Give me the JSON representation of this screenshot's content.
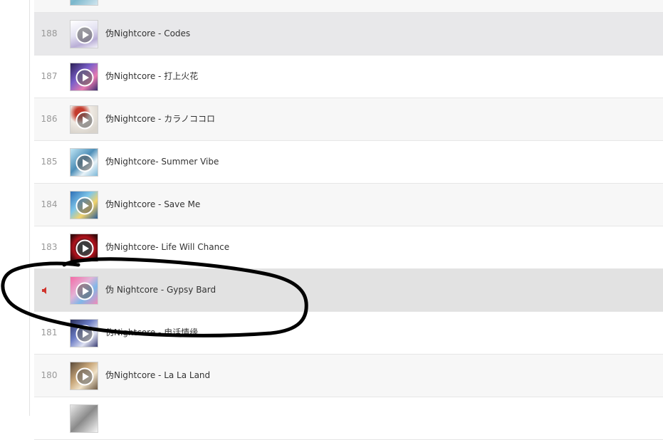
{
  "tracks": [
    {
      "index": "",
      "title": ""
    },
    {
      "index": "188",
      "title": "伪Nightcore - Codes"
    },
    {
      "index": "187",
      "title": "伪Nightcore - 打上火花"
    },
    {
      "index": "186",
      "title": "伪Nightcore - カラノココロ"
    },
    {
      "index": "185",
      "title": "伪Nightcore- Summer Vibe"
    },
    {
      "index": "184",
      "title": "伪Nightcore - Save Me"
    },
    {
      "index": "183",
      "title": "伪Nightcore- Life Will Chance"
    },
    {
      "index": "",
      "title": "伪 Nightcore - Gypsy Bard",
      "playing": true
    },
    {
      "index": "181",
      "title": "伪Nightcore - 电话情缘"
    },
    {
      "index": "180",
      "title": "伪Nightcore - La La Land"
    },
    {
      "index": "",
      "title": ""
    }
  ],
  "colors": {
    "playing_indicator": "#d0342c",
    "annotation_stroke": "#000000"
  },
  "icons": {
    "playing": "speaker-icon",
    "cover_overlay": "play-circle-icon"
  }
}
